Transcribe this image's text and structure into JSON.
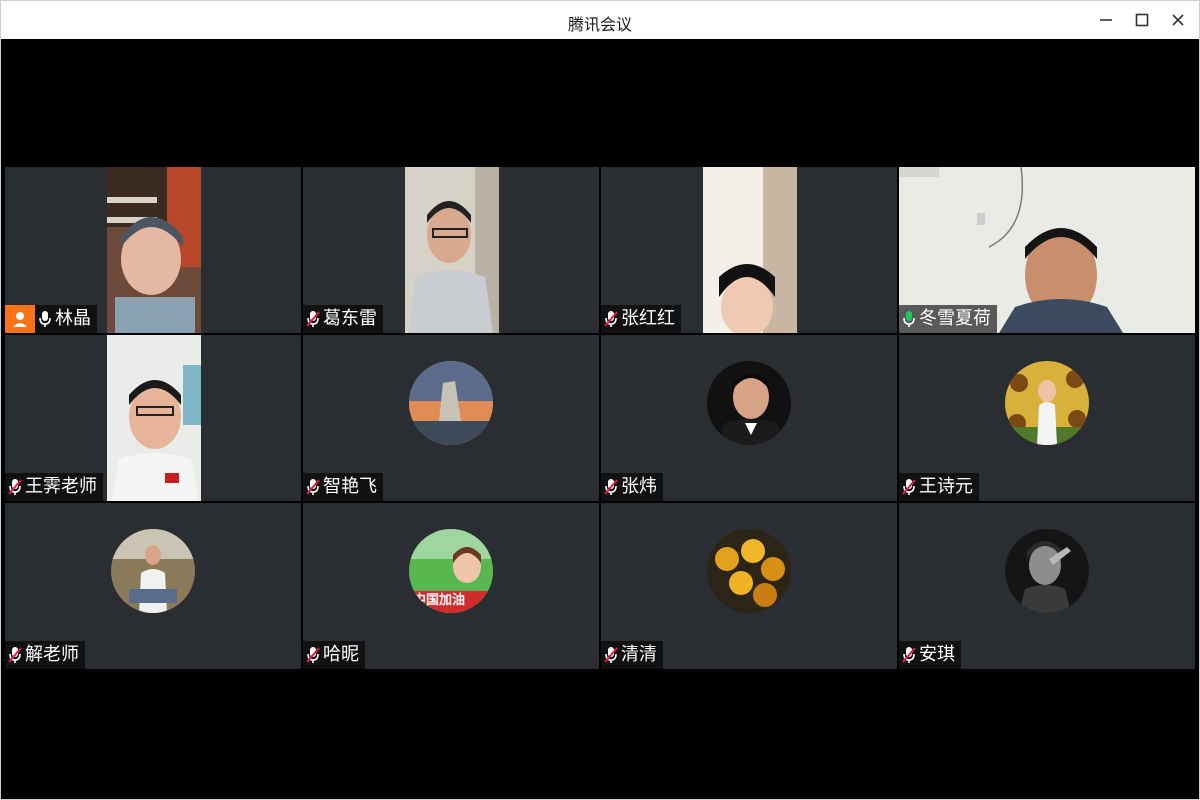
{
  "window": {
    "title": "腾讯会议",
    "controls": [
      "minimize-icon",
      "maximize-icon",
      "close-icon"
    ]
  },
  "participants": [
    {
      "name": "林晶",
      "role": "host",
      "mic": "on",
      "media": "video"
    },
    {
      "name": "葛东雷",
      "mic": "muted",
      "media": "video"
    },
    {
      "name": "张红红",
      "mic": "muted",
      "media": "video"
    },
    {
      "name": "冬雪夏荷",
      "mic": "speaking",
      "media": "video",
      "active": true
    },
    {
      "name": "王霁老师",
      "mic": "muted",
      "media": "video"
    },
    {
      "name": "智艳飞",
      "mic": "muted",
      "media": "avatar"
    },
    {
      "name": "张炜",
      "mic": "muted",
      "media": "avatar"
    },
    {
      "name": "王诗元",
      "mic": "muted",
      "media": "avatar"
    },
    {
      "name": "解老师",
      "mic": "muted",
      "media": "avatar"
    },
    {
      "name": "哈昵",
      "mic": "muted",
      "media": "avatar",
      "avatar_text": "中国加油"
    },
    {
      "name": "清清",
      "mic": "muted",
      "media": "avatar"
    },
    {
      "name": "安琪",
      "mic": "muted",
      "media": "avatar"
    }
  ],
  "colors": {
    "tile_bg": "#2a2d31",
    "active_border": "#22c55e",
    "host_badge": "#f97316",
    "muted_red": "#e11d48"
  }
}
